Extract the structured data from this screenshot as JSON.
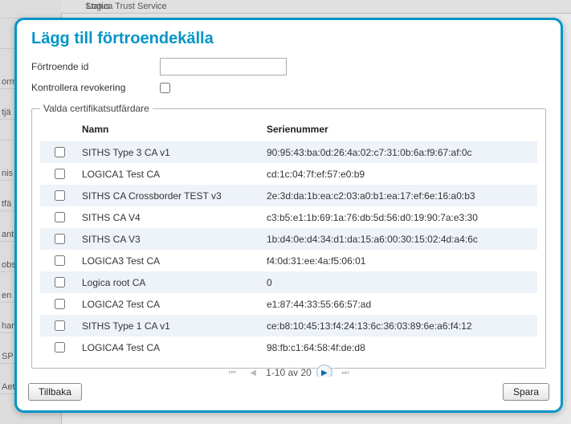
{
  "background": {
    "top_label": "Status",
    "top_value": "Logica Trust Service",
    "side_items": [
      "",
      "",
      "orm",
      "tjä",
      "",
      "nis",
      "tfä",
      "ant",
      "obs",
      "en",
      "har",
      "SP",
      "Aet"
    ]
  },
  "dialog": {
    "title": "Lägg till förtroendekälla",
    "form": {
      "id_label": "Förtroende id",
      "id_value": "",
      "revoke_label": "Kontrollera revokering",
      "revoke_checked": false
    },
    "fieldset_legend": "Valda certifikatsutfärdare",
    "table": {
      "headers": {
        "name": "Namn",
        "serial": "Serienummer"
      },
      "rows": [
        {
          "name": "SITHS Type 3 CA v1",
          "serial": "90:95:43:ba:0d:26:4a:02:c7:31:0b:6a:f9:67:af:0c"
        },
        {
          "name": "LOGICA1 Test CA",
          "serial": "cd:1c:04:7f:ef:57:e0:b9"
        },
        {
          "name": "SITHS CA Crossborder TEST v3",
          "serial": "2e:3d:da:1b:ea:c2:03:a0:b1:ea:17:ef:6e:16:a0:b3"
        },
        {
          "name": "SITHS CA V4",
          "serial": "c3:b5:e1:1b:69:1a:76:db:5d:56:d0:19:90:7a:e3:30"
        },
        {
          "name": "SITHS CA V3",
          "serial": "1b:d4:0e:d4:34:d1:da:15:a6:00:30:15:02:4d:a4:6c"
        },
        {
          "name": "LOGICA3 Test CA",
          "serial": "f4:0d:31:ee:4a:f5:06:01"
        },
        {
          "name": "Logica root CA",
          "serial": "0"
        },
        {
          "name": "LOGICA2 Test CA",
          "serial": "e1:87:44:33:55:66:57:ad"
        },
        {
          "name": "SITHS Type 1 CA v1",
          "serial": "ce:b8:10:45:13:f4:24:13:6c:36:03:89:6e:a6:f4:12"
        },
        {
          "name": "LOGICA4 Test CA",
          "serial": "98:fb:c1:64:58:4f:de:d8"
        }
      ]
    },
    "paginator": {
      "text": "1-10 av 20"
    },
    "buttons": {
      "back": "Tillbaka",
      "save": "Spara"
    }
  }
}
